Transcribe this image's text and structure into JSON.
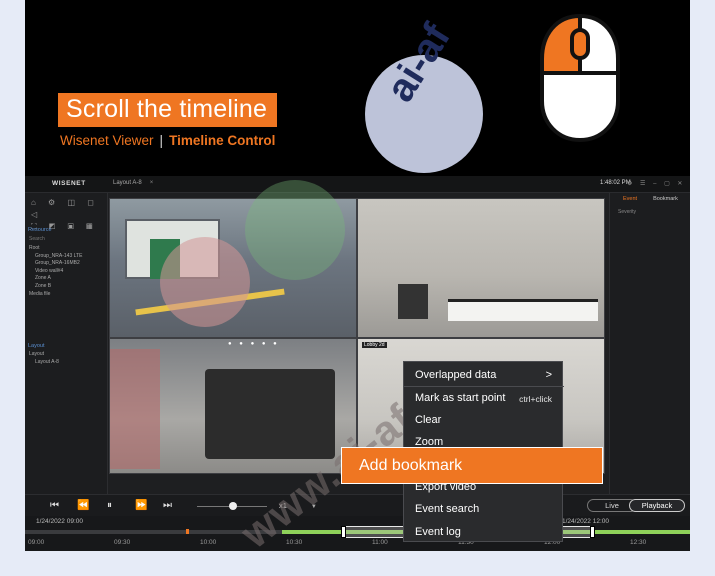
{
  "hero": {
    "title": "Scroll the timeline",
    "subtitle_left": "Wisenet Viewer",
    "subtitle_sep": "|",
    "subtitle_right": "Timeline Control"
  },
  "app": {
    "logo": "WISENET",
    "tab_label": "Layout A-8",
    "clock": "1:48:02 PM",
    "left_panel": {
      "resource_header": "Resource",
      "search_placeholder": "Search",
      "resource_items": [
        "Root",
        "Group_NRA-143 LTE",
        "Group_NRA-16MB2",
        "Video wall#4",
        "Zone A",
        "Zone B",
        "Media file"
      ],
      "layout_header": "Layout",
      "layout_items": [
        "Layout",
        "Layout A-8"
      ]
    },
    "right_panel": {
      "tab_event": "Event",
      "tab_bookmark": "Bookmark",
      "filter": "Severity"
    },
    "video4_label": "Lobby 2d"
  },
  "context_menu": {
    "items": [
      {
        "label": "Overlapped data",
        "arrow": ">"
      },
      {
        "label": "Mark as start point",
        "shortcut": "ctrl+click"
      },
      {
        "label": "Clear"
      },
      {
        "label": "Zoom"
      },
      {
        "label": "Add bookmark"
      },
      {
        "label": "Export video"
      },
      {
        "label": "Event search"
      },
      {
        "label": "Event log"
      }
    ]
  },
  "controls": {
    "speed": "x1",
    "live": "Live",
    "playback": "Playback"
  },
  "timeline": {
    "date_left": "1/24/2022 09:00",
    "date_right": "1/24/2022 12:00",
    "ticks": [
      "09:00",
      "09:30",
      "10:00",
      "10:30",
      "11:00",
      "11:30",
      "12:00",
      "12:30"
    ]
  },
  "watermark": {
    "logo": "ai-af",
    "url": "www.ai-af.vn"
  },
  "colors": {
    "accent": "#ef7622",
    "timeline_green": "#8fd15a",
    "background": "#000000",
    "page": "#e6ebf7"
  }
}
